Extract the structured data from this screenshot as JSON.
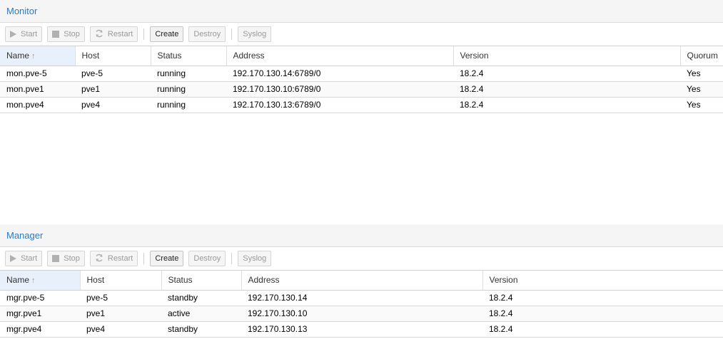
{
  "monitor": {
    "title": "Monitor",
    "toolbar": {
      "start": "Start",
      "stop": "Stop",
      "restart": "Restart",
      "create": "Create",
      "destroy": "Destroy",
      "syslog": "Syslog"
    },
    "columns": [
      "Name",
      "Host",
      "Status",
      "Address",
      "Version",
      "Quorum"
    ],
    "rows": [
      [
        "mon.pve-5",
        "pve-5",
        "running",
        "192.170.130.14:6789/0",
        "18.2.4",
        "Yes"
      ],
      [
        "mon.pve1",
        "pve1",
        "running",
        "192.170.130.10:6789/0",
        "18.2.4",
        "Yes"
      ],
      [
        "mon.pve4",
        "pve4",
        "running",
        "192.170.130.13:6789/0",
        "18.2.4",
        "Yes"
      ]
    ]
  },
  "manager": {
    "title": "Manager",
    "toolbar": {
      "start": "Start",
      "stop": "Stop",
      "restart": "Restart",
      "create": "Create",
      "destroy": "Destroy",
      "syslog": "Syslog"
    },
    "columns": [
      "Name",
      "Host",
      "Status",
      "Address",
      "Version"
    ],
    "rows": [
      [
        "mgr.pve-5",
        "pve-5",
        "standby",
        "192.170.130.14",
        "18.2.4"
      ],
      [
        "mgr.pve1",
        "pve1",
        "active",
        "192.170.130.10",
        "18.2.4"
      ],
      [
        "mgr.pve4",
        "pve4",
        "standby",
        "192.170.130.13",
        "18.2.4"
      ]
    ]
  },
  "icons": {
    "start": "play-icon",
    "stop": "stop-icon",
    "restart": "refresh-icon",
    "sort": "sort-ascending-icon"
  },
  "colors": {
    "panel_title": "#2d7ac0",
    "sorted_header": "#e8f0fb"
  }
}
